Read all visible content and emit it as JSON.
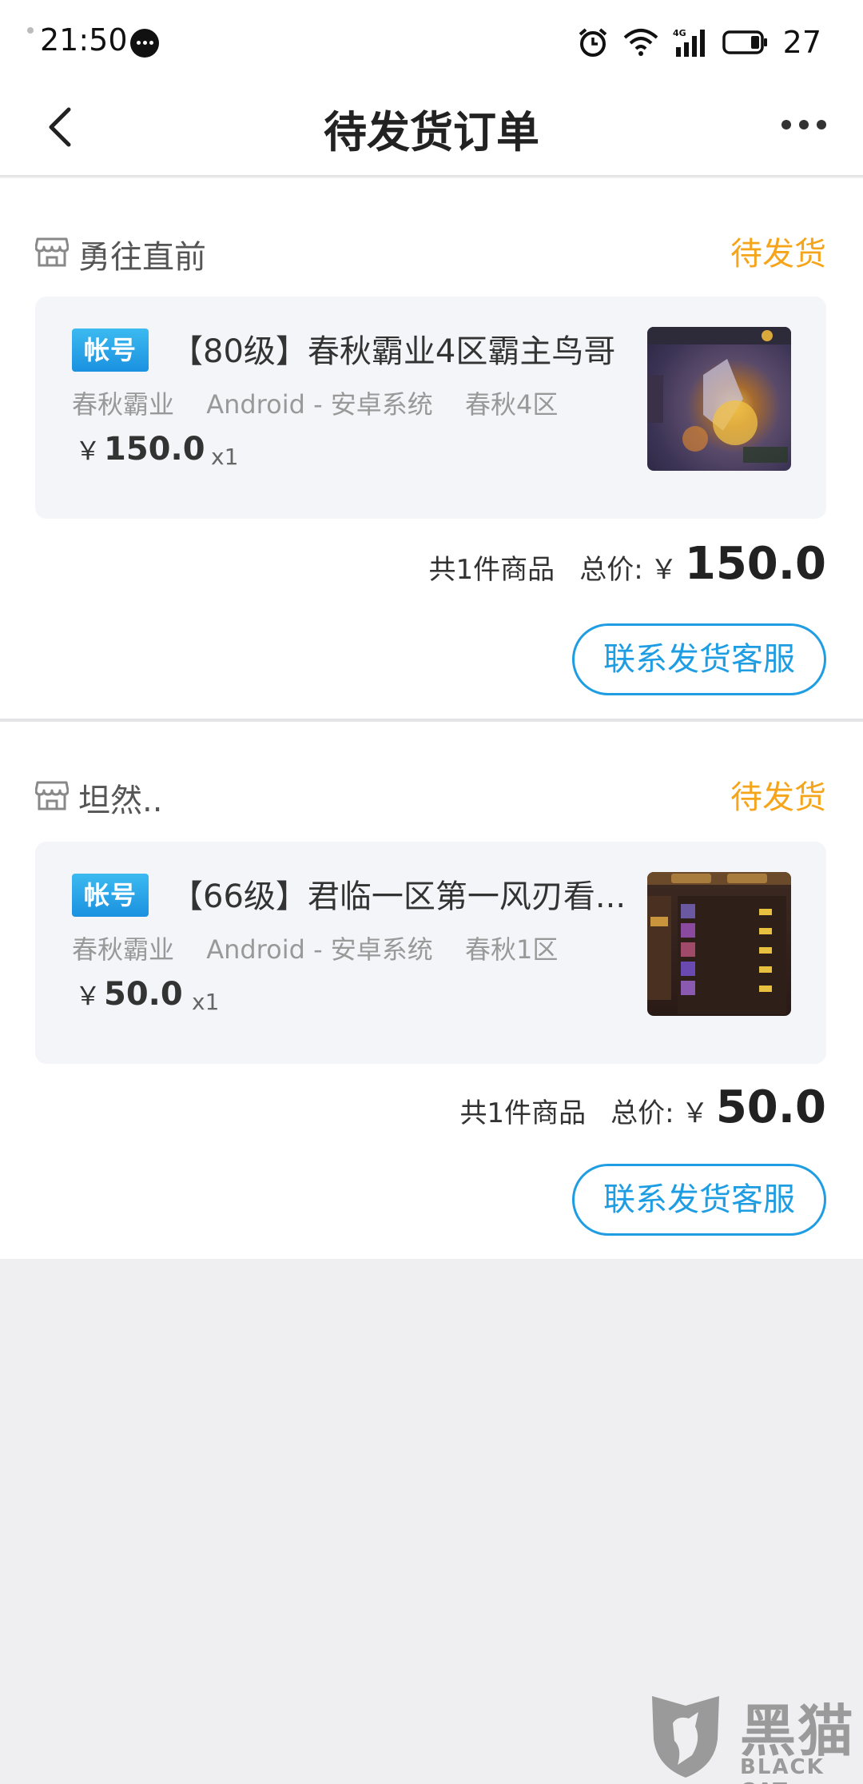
{
  "status_bar": {
    "time": "21:50",
    "battery": "27",
    "network": "4G",
    "icons": [
      "message-icon",
      "alarm-icon",
      "wifi-icon",
      "signal-icon",
      "battery-icon"
    ]
  },
  "nav": {
    "title": "待发货订单",
    "back_icon": "chevron-left-icon",
    "more_icon": "more-dots-icon"
  },
  "orders": [
    {
      "shop_name": "勇往直前",
      "status": "待发货",
      "badge": "帐号",
      "title": "【80级】春秋霸业4区霸主鸟哥",
      "meta": [
        "春秋霸业",
        "Android - 安卓系统",
        "春秋4区"
      ],
      "currency": "￥",
      "price": "150.0",
      "qty": "x1",
      "count_text": "共1件商品",
      "total_label": "总价:",
      "total": "150.0",
      "button": "联系发货客服"
    },
    {
      "shop_name": "坦然..",
      "status": "待发货",
      "badge": "帐号",
      "title": "【66级】君临一区第一风刃看...",
      "meta": [
        "春秋霸业",
        "Android - 安卓系统",
        "春秋1区"
      ],
      "currency": "￥",
      "price": "50.0",
      "qty": "x1",
      "count_text": "共1件商品",
      "total_label": "总价:",
      "total": "50.0",
      "button": "联系发货客服"
    }
  ],
  "watermark": {
    "cn": "黑猫",
    "en": "BLACK CAT"
  },
  "colors": {
    "accent_blue": "#1e9de3",
    "status_orange": "#f5a51b",
    "page_bg": "#efeff1"
  }
}
